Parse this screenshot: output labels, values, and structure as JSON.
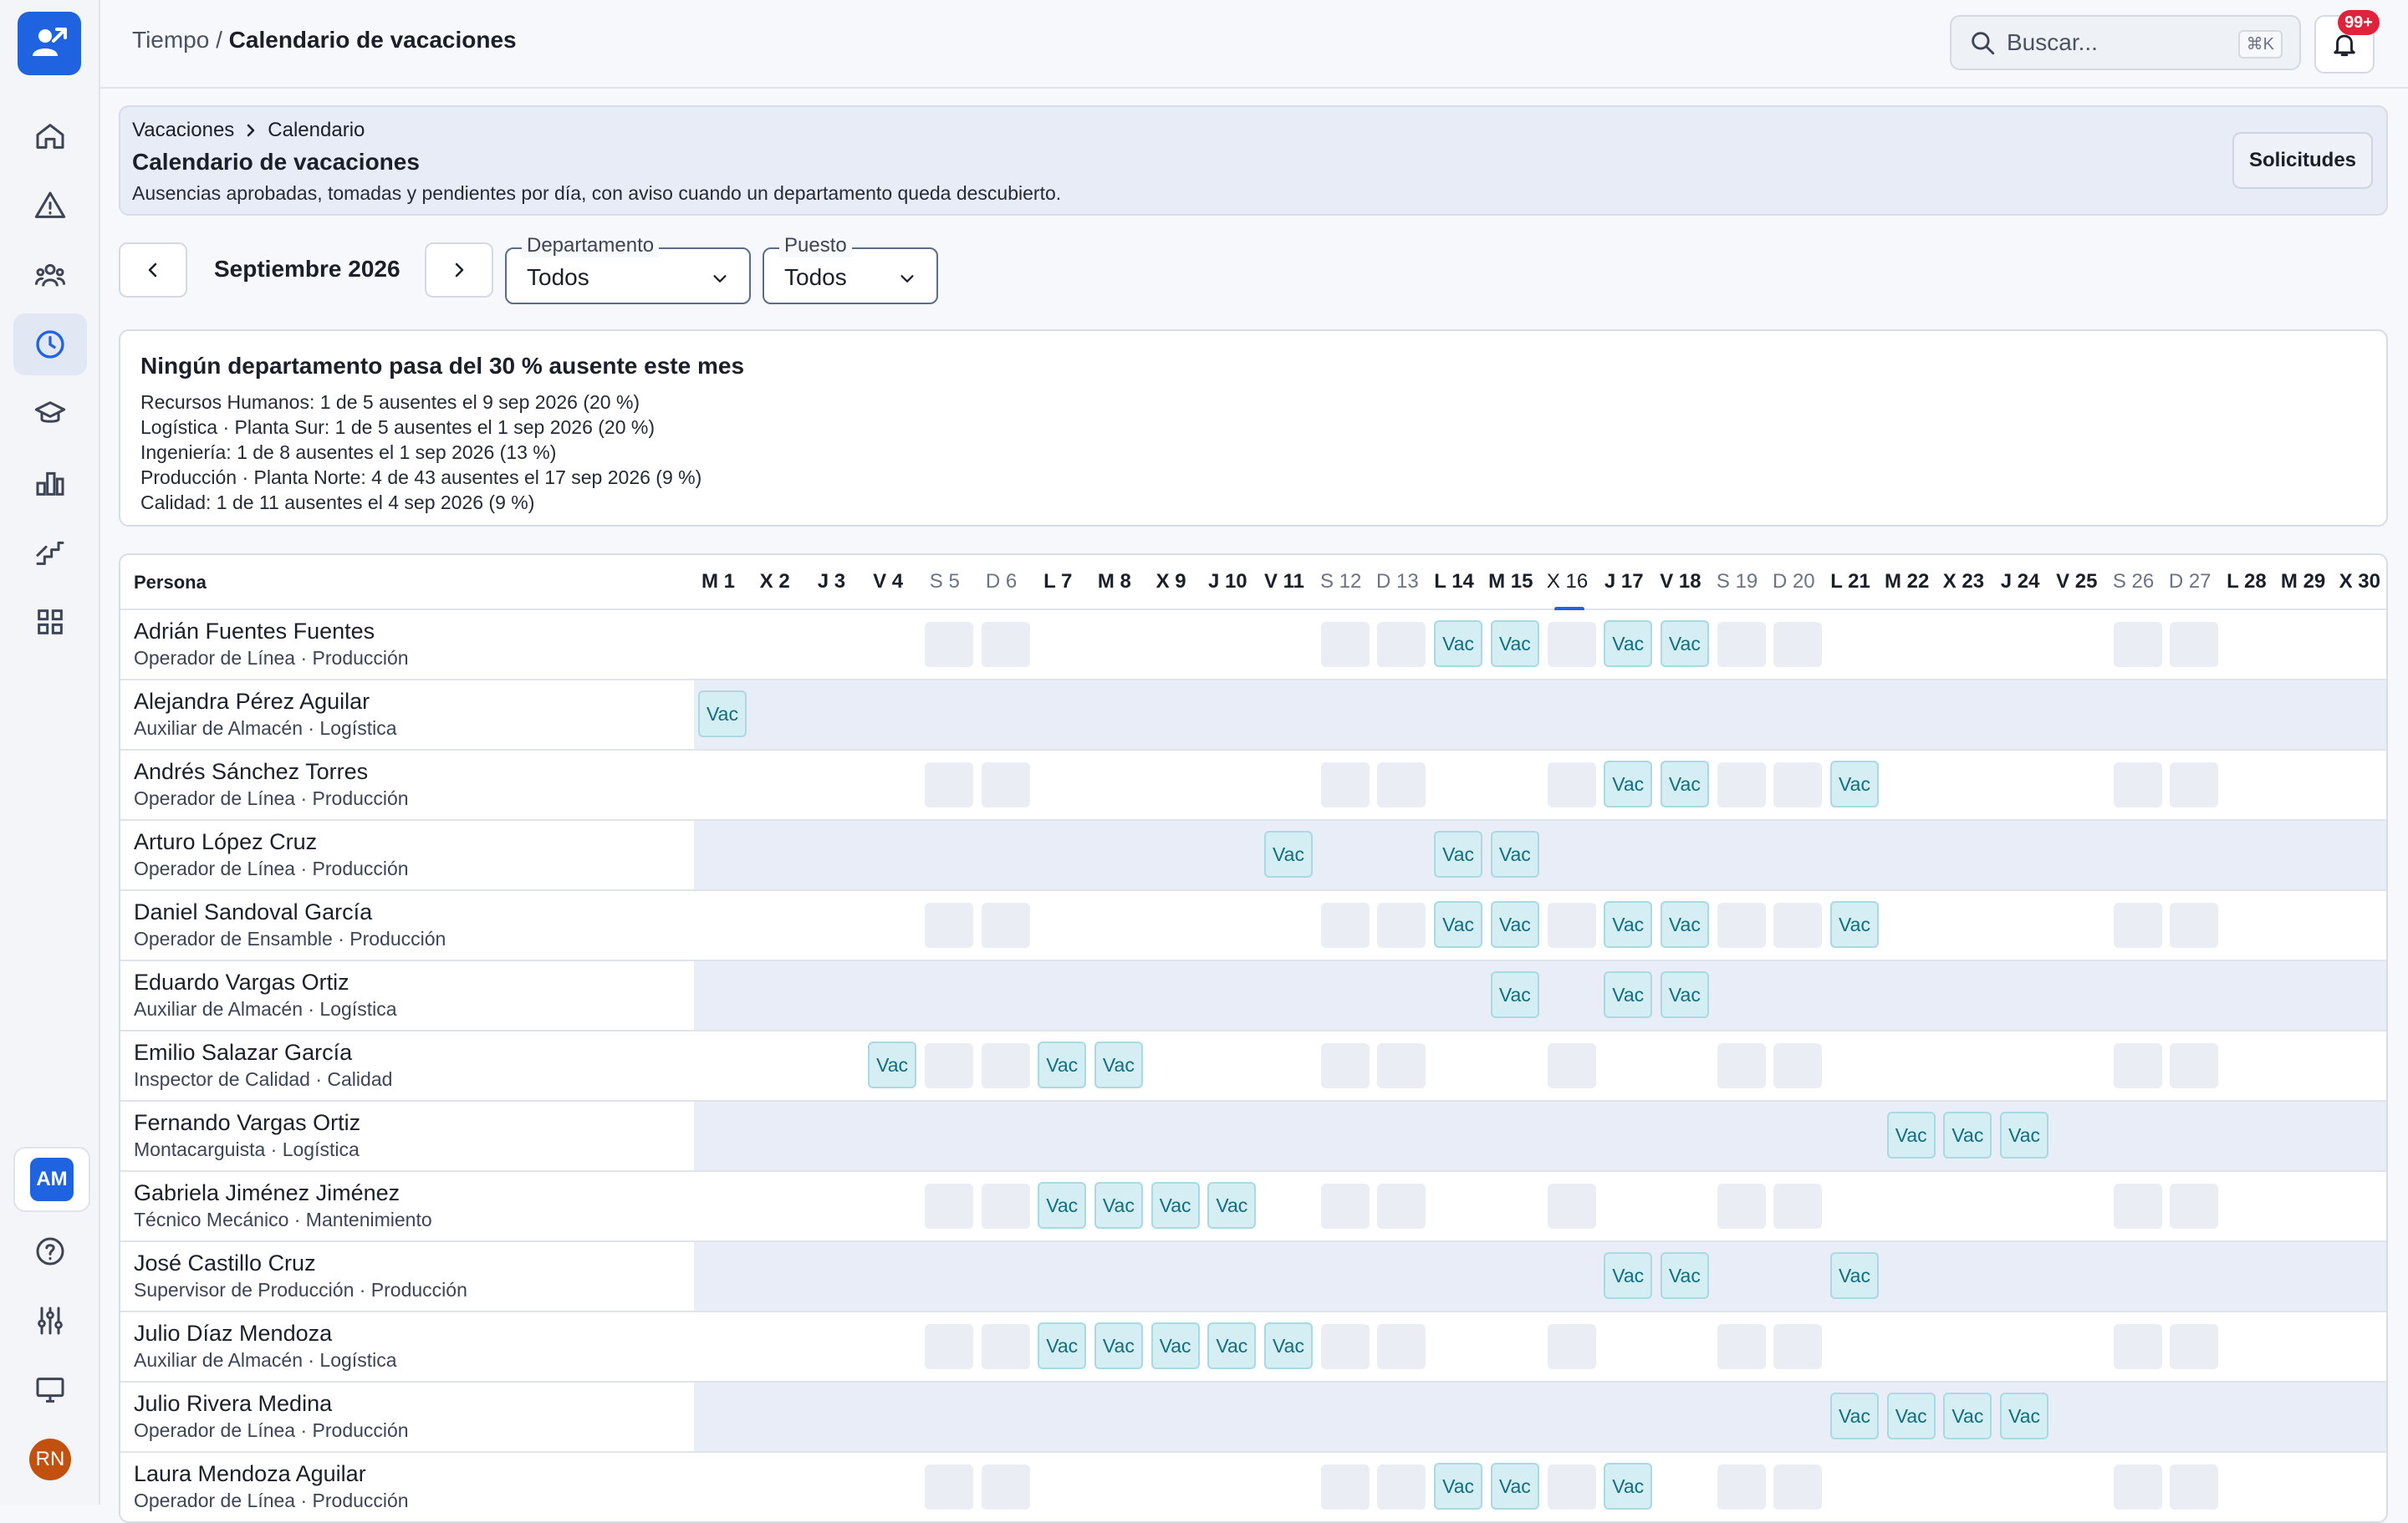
{
  "topbar": {
    "crumb_parent": "Tiempo",
    "crumb_sep": " / ",
    "crumb_current": "Calendario de vacaciones",
    "search_placeholder": "Buscar...",
    "search_kbd": "⌘K",
    "notif_badge": "99+"
  },
  "sidebar": {
    "items": [
      {
        "icon": "home-icon"
      },
      {
        "icon": "alert-triangle-icon"
      },
      {
        "icon": "people-icon"
      },
      {
        "icon": "clock-icon",
        "active": true
      },
      {
        "icon": "graduation-cap-icon"
      },
      {
        "icon": "bar-chart-icon"
      },
      {
        "icon": "career-steps-icon"
      },
      {
        "icon": "grid-icon"
      }
    ],
    "workspace_initials": "AM",
    "user_initials": "RN"
  },
  "header": {
    "breadcrumb": [
      "Vacaciones",
      "Calendario"
    ],
    "title": "Calendario de vacaciones",
    "subtitle": "Ausencias aprobadas, tomadas y pendientes por día, con aviso cuando un departamento queda descubierto.",
    "button": "Solicitudes"
  },
  "filters": {
    "month": "Septiembre 2026",
    "department": {
      "label": "Departamento",
      "value": "Todos"
    },
    "position": {
      "label": "Puesto",
      "value": "Todos"
    }
  },
  "alert": {
    "title": "Ningún departamento pasa del 30 % ausente este mes",
    "lines": [
      "Recursos Humanos: 1 de 5 ausentes el 9 sep 2026 (20 %)",
      "Logística · Planta Sur: 1 de 5 ausentes el 1 sep 2026 (20 %)",
      "Ingeniería: 1 de 8 ausentes el 1 sep 2026 (13 %)",
      "Producción · Planta Norte: 4 de 43 ausentes el 17 sep 2026 (9 %)",
      "Calidad: 1 de 11 ausentes el 4 sep 2026 (9 %)"
    ]
  },
  "calendar": {
    "persona_header": "Persona",
    "today_index": 15,
    "vac_label": "Vac",
    "days": [
      {
        "label": "M 1",
        "weekend": false
      },
      {
        "label": "X 2",
        "weekend": false
      },
      {
        "label": "J 3",
        "weekend": false
      },
      {
        "label": "V 4",
        "weekend": false
      },
      {
        "label": "S 5",
        "weekend": true
      },
      {
        "label": "D 6",
        "weekend": true
      },
      {
        "label": "L 7",
        "weekend": false
      },
      {
        "label": "M 8",
        "weekend": false
      },
      {
        "label": "X 9",
        "weekend": false
      },
      {
        "label": "J 10",
        "weekend": false
      },
      {
        "label": "V 11",
        "weekend": false
      },
      {
        "label": "S 12",
        "weekend": true
      },
      {
        "label": "D 13",
        "weekend": true
      },
      {
        "label": "L 14",
        "weekend": false
      },
      {
        "label": "M 15",
        "weekend": false
      },
      {
        "label": "X 16",
        "weekend": false
      },
      {
        "label": "J 17",
        "weekend": false
      },
      {
        "label": "V 18",
        "weekend": false
      },
      {
        "label": "S 19",
        "weekend": true
      },
      {
        "label": "D 20",
        "weekend": true
      },
      {
        "label": "L 21",
        "weekend": false
      },
      {
        "label": "M 22",
        "weekend": false
      },
      {
        "label": "X 23",
        "weekend": false
      },
      {
        "label": "J 24",
        "weekend": false
      },
      {
        "label": "V 25",
        "weekend": false
      },
      {
        "label": "S 26",
        "weekend": true
      },
      {
        "label": "D 27",
        "weekend": true
      },
      {
        "label": "L 28",
        "weekend": false
      },
      {
        "label": "M 29",
        "weekend": false
      },
      {
        "label": "X 30",
        "weekend": false
      }
    ],
    "rows": [
      {
        "name": "Adrián Fuentes Fuentes",
        "role": "Operador de Línea · Producción",
        "shaded": false,
        "vac_days": [
          14,
          15,
          17,
          18
        ]
      },
      {
        "name": "Alejandra Pérez Aguilar",
        "role": "Auxiliar de Almacén · Logística",
        "shaded": true,
        "vac_days": [
          1
        ]
      },
      {
        "name": "Andrés Sánchez Torres",
        "role": "Operador de Línea · Producción",
        "shaded": false,
        "vac_days": [
          17,
          18,
          21
        ]
      },
      {
        "name": "Arturo López Cruz",
        "role": "Operador de Línea · Producción",
        "shaded": true,
        "vac_days": [
          11,
          14,
          15
        ]
      },
      {
        "name": "Daniel Sandoval García",
        "role": "Operador de Ensamble · Producción",
        "shaded": false,
        "vac_days": [
          14,
          15,
          17,
          18,
          21
        ]
      },
      {
        "name": "Eduardo Vargas Ortiz",
        "role": "Auxiliar de Almacén · Logística",
        "shaded": true,
        "vac_days": [
          15,
          17,
          18
        ]
      },
      {
        "name": "Emilio Salazar García",
        "role": "Inspector de Calidad · Calidad",
        "shaded": false,
        "vac_days": [
          4,
          7,
          8
        ]
      },
      {
        "name": "Fernando Vargas Ortiz",
        "role": "Montacarguista · Logística",
        "shaded": true,
        "vac_days": [
          22,
          23,
          24
        ]
      },
      {
        "name": "Gabriela Jiménez Jiménez",
        "role": "Técnico Mecánico · Mantenimiento",
        "shaded": false,
        "vac_days": [
          7,
          8,
          9,
          10
        ]
      },
      {
        "name": "José Castillo Cruz",
        "role": "Supervisor de Producción · Producción",
        "shaded": true,
        "vac_days": [
          17,
          18,
          21
        ]
      },
      {
        "name": "Julio Díaz Mendoza",
        "role": "Auxiliar de Almacén · Logística",
        "shaded": false,
        "vac_days": [
          7,
          8,
          9,
          10,
          11
        ]
      },
      {
        "name": "Julio Rivera Medina",
        "role": "Operador de Línea · Producción",
        "shaded": true,
        "vac_days": [
          21,
          22,
          23,
          24
        ]
      },
      {
        "name": "Laura Mendoza Aguilar",
        "role": "Operador de Línea · Producción",
        "shaded": false,
        "vac_days": [
          14,
          15,
          17
        ]
      }
    ]
  }
}
